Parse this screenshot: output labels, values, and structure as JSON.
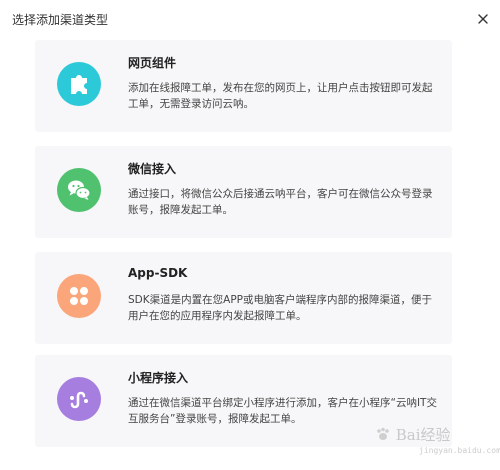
{
  "dialog": {
    "title": "选择添加渠道类型"
  },
  "cards": [
    {
      "name": "网页组件",
      "description": "添加在线报障工单，发布在您的网页上，让用户点击按钮即可发起工单，无需登录访问云呐。",
      "icon": "puzzle-icon",
      "color": "#2cc9d8"
    },
    {
      "name": "微信接入",
      "description": "通过接口，将微信公众后接通云呐平台，客户可在微信公众号登录账号，报障发起工单。",
      "icon": "wechat-icon",
      "color": "#4fc16f"
    },
    {
      "name": "App-SDK",
      "description": "SDK渠道是内置在您APP或电脑客户端程序内部的报障渠道，便于用户在您的应用程序内发起报障工单。",
      "icon": "clover-icon",
      "color": "#fba57b"
    },
    {
      "name": "小程序接入",
      "description": "通过在微信渠道平台绑定小程序进行添加，客户在小程序“云呐IT交互服务台”登录账号，报障发起工单。",
      "icon": "miniprogram-icon",
      "color": "#a57ee0"
    }
  ],
  "watermark": {
    "text": "Bai经验",
    "sub": "jingyan.baidu.com"
  }
}
